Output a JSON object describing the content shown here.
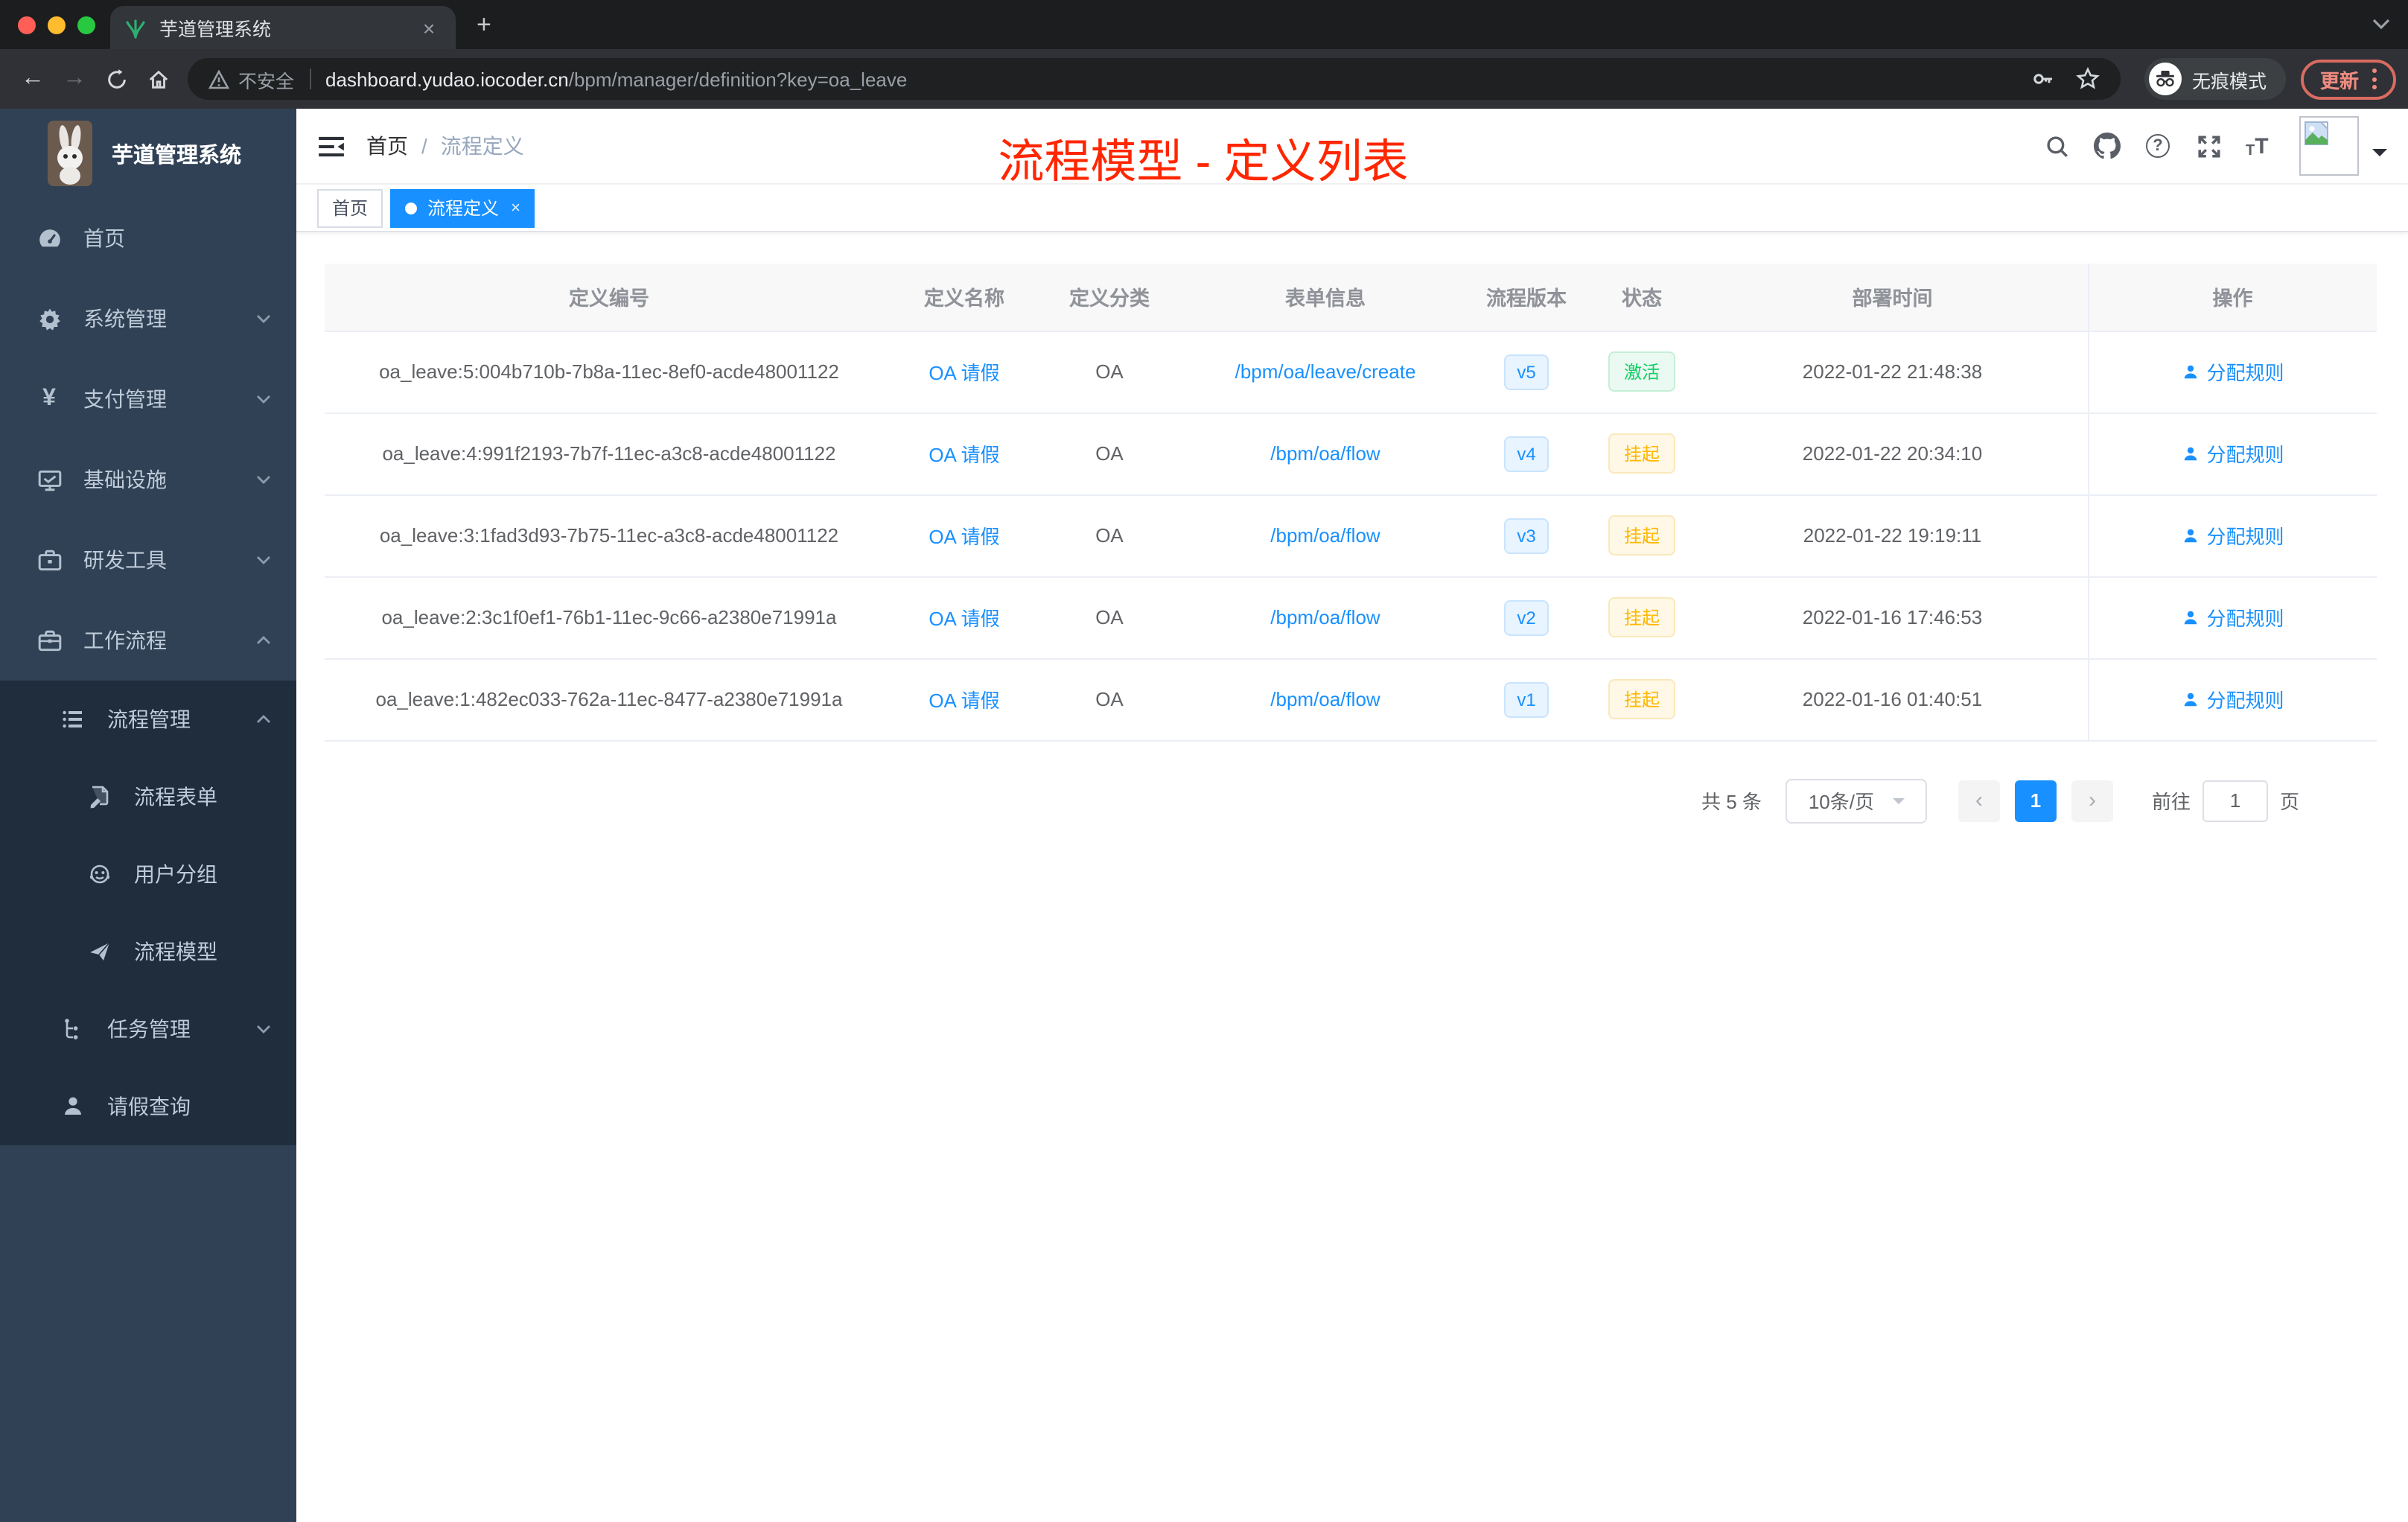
{
  "browser": {
    "tab_title": "芋道管理系统",
    "security_label": "不安全",
    "url_domain": "dashboard.yudao.iocoder.cn",
    "url_path": "/bpm/manager/definition?key=oa_leave",
    "incognito_label": "无痕模式",
    "update_label": "更新"
  },
  "icons": {
    "close": "×",
    "plus": "+",
    "back": "←",
    "forward": "→",
    "yen": "¥",
    "help": "?",
    "font_small": "T",
    "font_big": "T",
    "prev": "‹",
    "next": "›"
  },
  "sidebar": {
    "logo_title": "芋道管理系统",
    "items": [
      {
        "label": "首页"
      },
      {
        "label": "系统管理"
      },
      {
        "label": "支付管理"
      },
      {
        "label": "基础设施"
      },
      {
        "label": "研发工具"
      },
      {
        "label": "工作流程"
      }
    ],
    "workflow_submenu": {
      "process_group": {
        "label": "流程管理",
        "children": [
          {
            "label": "流程表单"
          },
          {
            "label": "用户分组"
          },
          {
            "label": "流程模型"
          }
        ]
      },
      "task_group": {
        "label": "任务管理"
      },
      "leave_item": {
        "label": "请假查询"
      }
    }
  },
  "header": {
    "breadcrumb": {
      "home": "首页",
      "separator": "/",
      "current": "流程定义"
    },
    "annotation": "流程模型 - 定义列表"
  },
  "tags": {
    "home": "首页",
    "active": "流程定义"
  },
  "table": {
    "columns": [
      "定义编号",
      "定义名称",
      "定义分类",
      "表单信息",
      "流程版本",
      "状态",
      "部署时间",
      "操作"
    ],
    "rows": [
      {
        "id": "oa_leave:5:004b710b-7b8a-11ec-8ef0-acde48001122",
        "name": "OA 请假",
        "category": "OA",
        "form": "/bpm/oa/leave/create",
        "version": "v5",
        "status": "激活",
        "deploy_time": "2022-01-22 21:48:38",
        "action": "分配规则"
      },
      {
        "id": "oa_leave:4:991f2193-7b7f-11ec-a3c8-acde48001122",
        "name": "OA 请假",
        "category": "OA",
        "form": "/bpm/oa/flow",
        "version": "v4",
        "status": "挂起",
        "deploy_time": "2022-01-22 20:34:10",
        "action": "分配规则"
      },
      {
        "id": "oa_leave:3:1fad3d93-7b75-11ec-a3c8-acde48001122",
        "name": "OA 请假",
        "category": "OA",
        "form": "/bpm/oa/flow",
        "version": "v3",
        "status": "挂起",
        "deploy_time": "2022-01-22 19:19:11",
        "action": "分配规则"
      },
      {
        "id": "oa_leave:2:3c1f0ef1-76b1-11ec-9c66-a2380e71991a",
        "name": "OA 请假",
        "category": "OA",
        "form": "/bpm/oa/flow",
        "version": "v2",
        "status": "挂起",
        "deploy_time": "2022-01-16 17:46:53",
        "action": "分配规则"
      },
      {
        "id": "oa_leave:1:482ec033-762a-11ec-8477-a2380e71991a",
        "name": "OA 请假",
        "category": "OA",
        "form": "/bpm/oa/flow",
        "version": "v1",
        "status": "挂起",
        "deploy_time": "2022-01-16 01:40:51",
        "action": "分配规则"
      }
    ]
  },
  "pagination": {
    "total_label": "共 5 条",
    "page_size": "10条/页",
    "current_page": "1",
    "goto_label": "前往",
    "goto_value": "1",
    "page_unit": "页"
  },
  "colors": {
    "accent_blue": "#1890ff",
    "sidebar_bg": "#304156",
    "submenu_bg": "#1f2d3d",
    "status_active_green": "#13ce66",
    "status_suspend_yellow": "#ffb800",
    "annotation_red": "#ff2600"
  }
}
